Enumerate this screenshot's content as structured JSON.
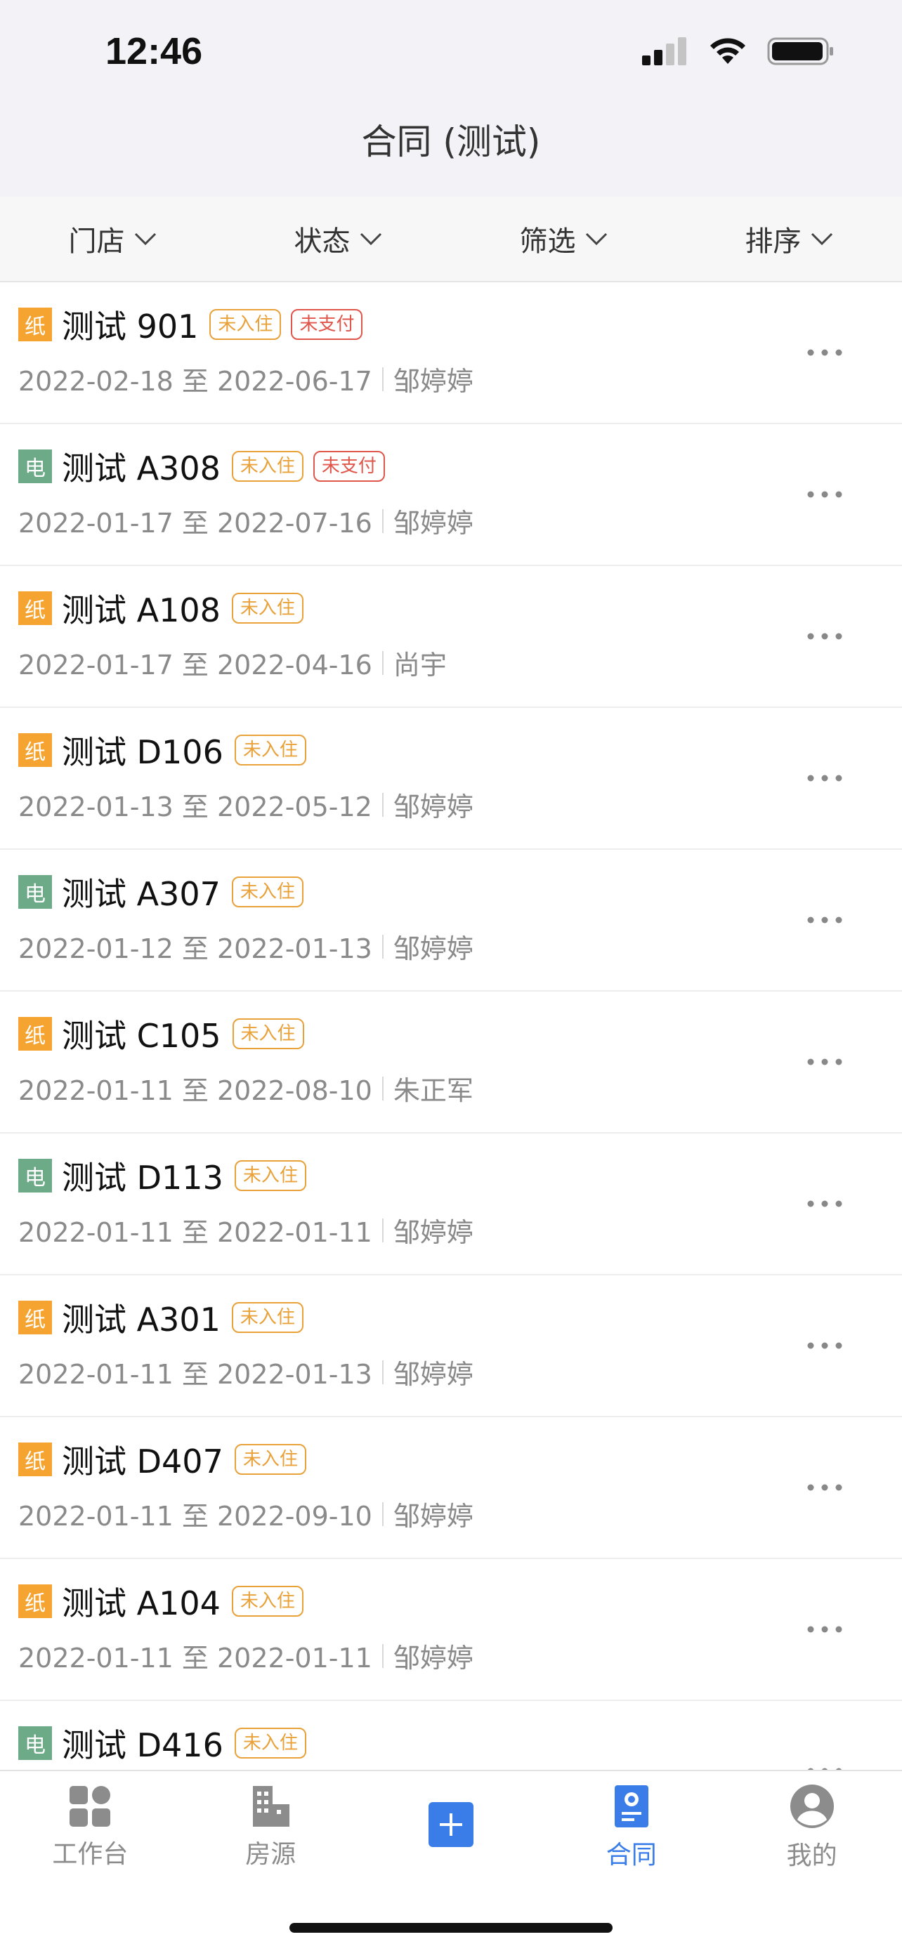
{
  "status_bar": {
    "time": "12:46"
  },
  "nav": {
    "title": "合同 (测试)"
  },
  "filters": [
    {
      "label": "门店"
    },
    {
      "label": "状态"
    },
    {
      "label": "筛选"
    },
    {
      "label": "排序"
    }
  ],
  "contracts": [
    {
      "type": "纸",
      "name": "测试 901",
      "tags": [
        "未入住",
        "未支付"
      ],
      "dates": "2022-02-18 至 2022-06-17",
      "person": "邹婷婷"
    },
    {
      "type": "电",
      "name": "测试 A308",
      "tags": [
        "未入住",
        "未支付"
      ],
      "dates": "2022-01-17 至 2022-07-16",
      "person": "邹婷婷"
    },
    {
      "type": "纸",
      "name": "测试 A108",
      "tags": [
        "未入住"
      ],
      "dates": "2022-01-17 至 2022-04-16",
      "person": "尚宇"
    },
    {
      "type": "纸",
      "name": "测试 D106",
      "tags": [
        "未入住"
      ],
      "dates": "2022-01-13 至 2022-05-12",
      "person": "邹婷婷"
    },
    {
      "type": "电",
      "name": "测试 A307",
      "tags": [
        "未入住"
      ],
      "dates": "2022-01-12 至 2022-01-13",
      "person": "邹婷婷"
    },
    {
      "type": "纸",
      "name": "测试 C105",
      "tags": [
        "未入住"
      ],
      "dates": "2022-01-11 至 2022-08-10",
      "person": "朱正军"
    },
    {
      "type": "电",
      "name": "测试 D113",
      "tags": [
        "未入住"
      ],
      "dates": "2022-01-11 至 2022-01-11",
      "person": "邹婷婷"
    },
    {
      "type": "纸",
      "name": "测试 A301",
      "tags": [
        "未入住"
      ],
      "dates": "2022-01-11 至 2022-01-13",
      "person": "邹婷婷"
    },
    {
      "type": "纸",
      "name": "测试 D407",
      "tags": [
        "未入住"
      ],
      "dates": "2022-01-11 至 2022-09-10",
      "person": "邹婷婷"
    },
    {
      "type": "纸",
      "name": "测试 A104",
      "tags": [
        "未入住"
      ],
      "dates": "2022-01-11 至 2022-01-11",
      "person": "邹婷婷"
    },
    {
      "type": "电",
      "name": "测试 D416",
      "tags": [
        "未入住"
      ],
      "dates": "",
      "person": ""
    }
  ],
  "tabs": [
    {
      "label": "工作台",
      "icon": "grid-apps-icon",
      "active": false
    },
    {
      "label": "房源",
      "icon": "building-icon",
      "active": false
    },
    {
      "label": "",
      "icon": "plus-icon",
      "active": false
    },
    {
      "label": "合同",
      "icon": "contract-icon",
      "active": true
    },
    {
      "label": "我的",
      "icon": "user-avatar-icon",
      "active": false
    }
  ],
  "colors": {
    "accent": "#3a7de8",
    "paper_badge": "#f5a431",
    "electronic_badge": "#6daa87",
    "tag_orange": "#e9a13a",
    "tag_red": "#e0564a"
  }
}
